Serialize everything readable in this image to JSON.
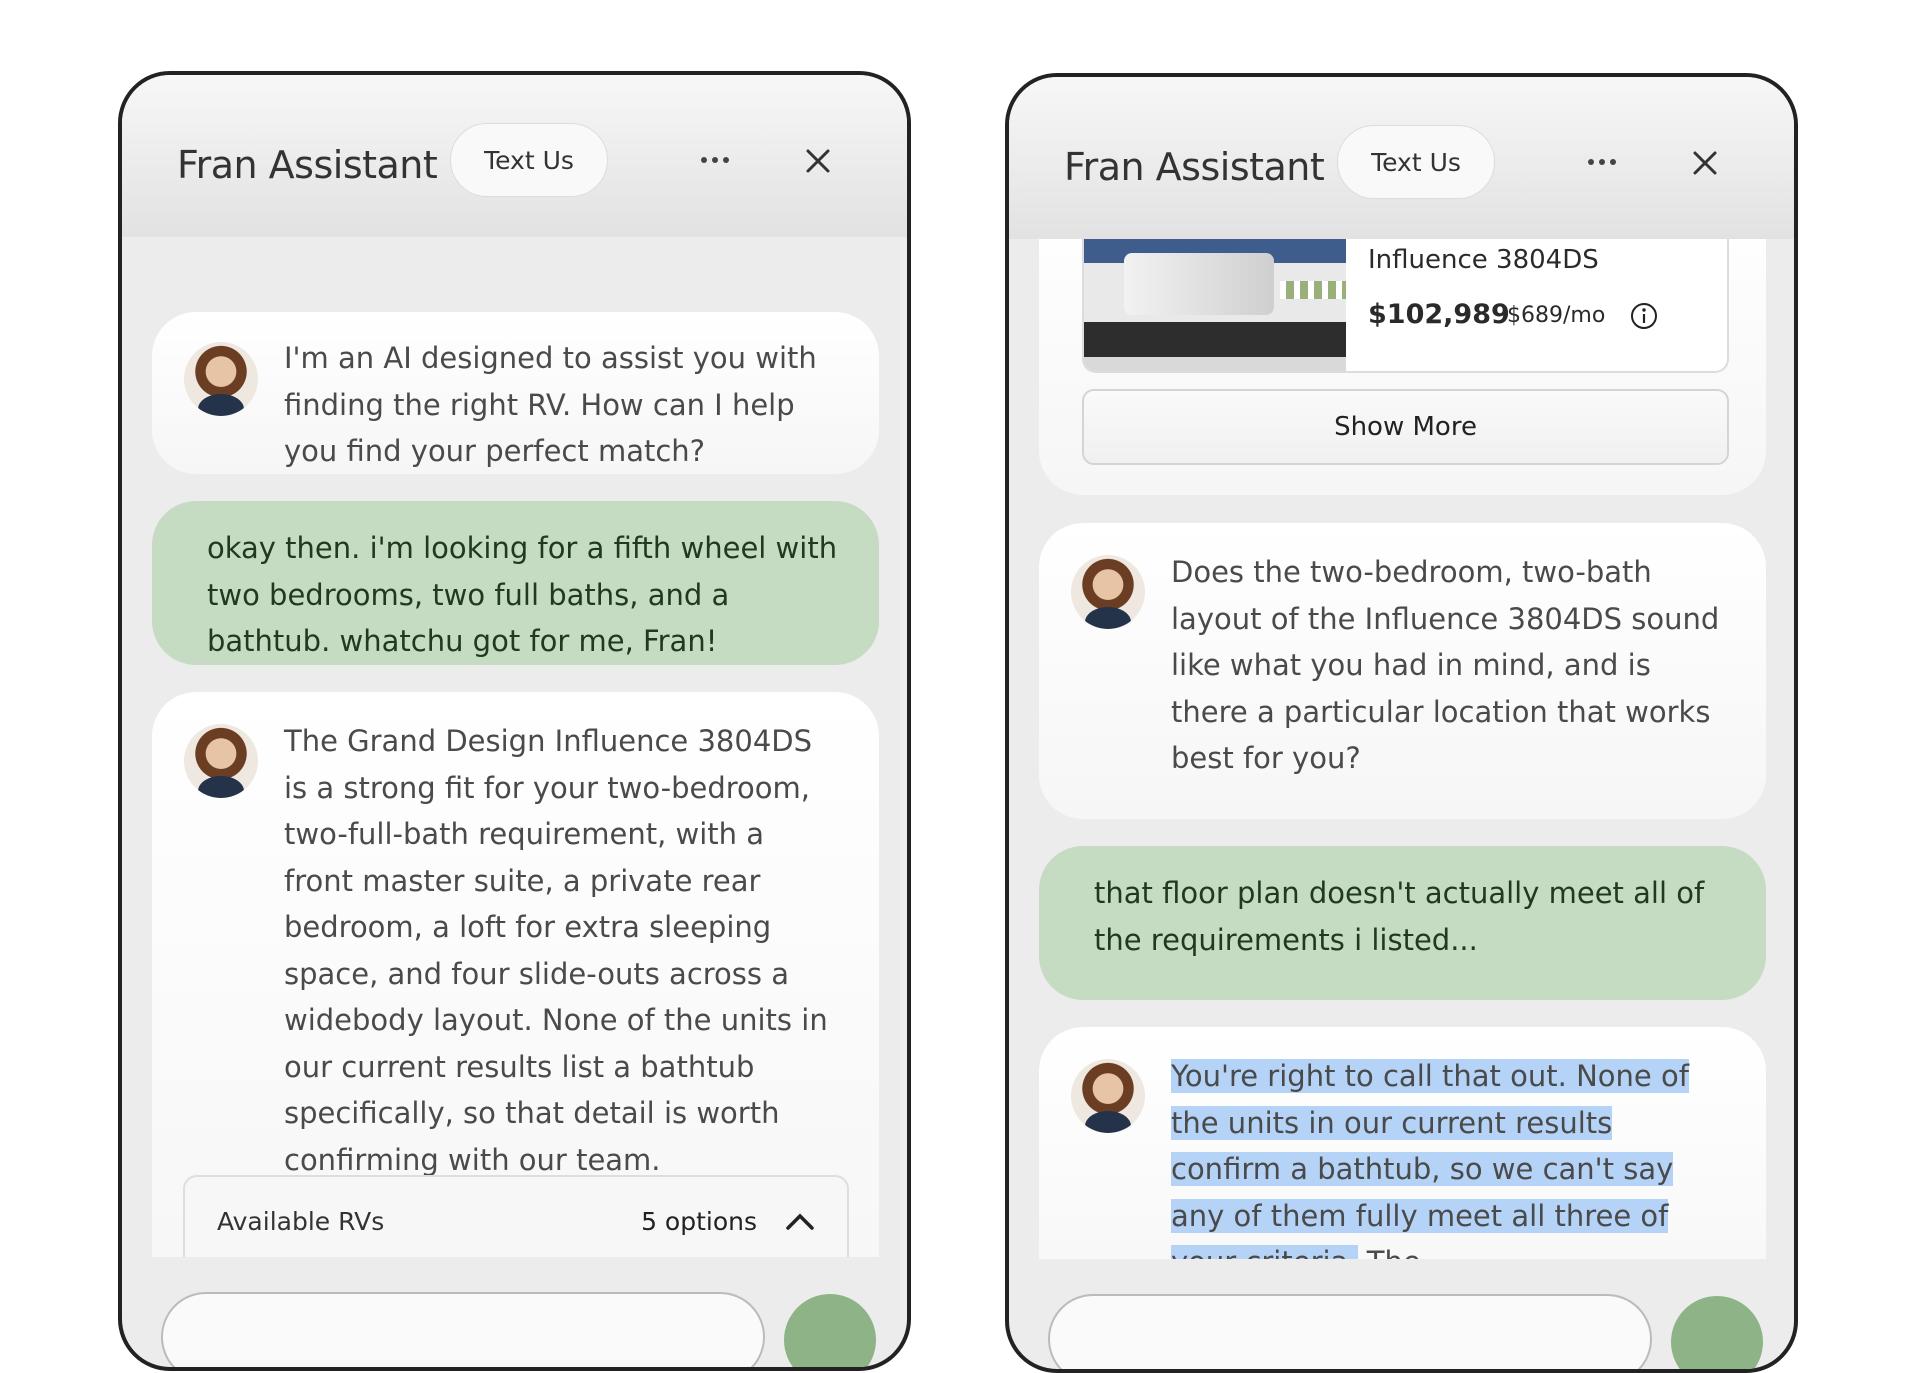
{
  "left": {
    "title": "Fran Assistant",
    "text_us": "Text Us",
    "messages": [
      {
        "role": "bot",
        "text": "I'm an AI designed to assist you with finding the right RV. How can I help you find your perfect match?"
      },
      {
        "role": "user",
        "text": "okay then. i'm looking for a fifth wheel with two bedrooms, two full baths, and a bathtub. whatchu got for me, Fran!"
      },
      {
        "role": "bot",
        "text": "The Grand Design Influence 3804DS is a strong fit for your two-bedroom, two-full-bath requirement, with a front master suite, a private rear bedroom, a loft for extra sleeping space, and four slide-outs across a widebody layout. None of the units in our current results list a bathtub specifically, so that detail is worth confirming with our team."
      }
    ],
    "available": {
      "label": "Available RVs",
      "count": "5 options"
    }
  },
  "right": {
    "title": "Fran Assistant",
    "text_us": "Text Us",
    "card": {
      "name": "Influence 3804DS",
      "price": "$102,989",
      "monthly": "$689/mo"
    },
    "show_more": "Show More",
    "messages": [
      {
        "role": "bot",
        "text": "Does the two-bedroom, two-bath layout of the Influence 3804DS sound like what you had in mind, and is there a particular location that works best for you?"
      },
      {
        "role": "user",
        "text": "that floor plan doesn't actually meet all of the requirements i listed..."
      },
      {
        "role": "bot",
        "highlighted": "You're right to call that out. None of the units in our current results confirm a bathtub, so we can't say any of them fully meet all three of your criteria.",
        "rest": " The"
      }
    ]
  },
  "colors": {
    "user_bubble": "#c5dbc2",
    "send_button": "#8eb387",
    "highlight": "#b5d3f7"
  }
}
